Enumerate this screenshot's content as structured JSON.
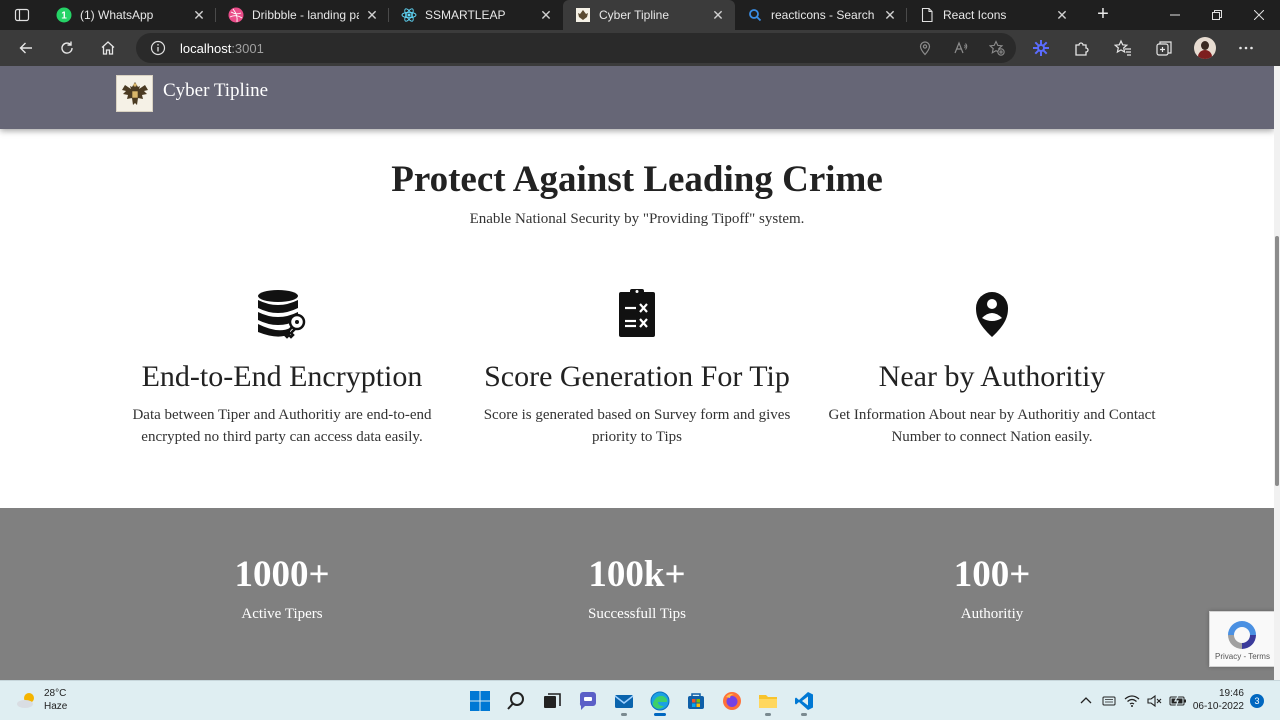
{
  "browser": {
    "tabs": [
      {
        "title": "(1) WhatsApp",
        "icon": "whatsapp-icon"
      },
      {
        "title": "Dribbble - landing pag",
        "icon": "dribbble-icon"
      },
      {
        "title": "SSMARTLEAP",
        "icon": "react-icon"
      },
      {
        "title": "Cyber Tipline",
        "icon": "site-logo-icon",
        "active": true
      },
      {
        "title": "reacticons - Search",
        "icon": "search-icon"
      },
      {
        "title": "React Icons",
        "icon": "document-icon"
      }
    ],
    "address": {
      "host": "localhost",
      "port": ":3001"
    }
  },
  "site": {
    "brand": "Cyber Tipline",
    "hero_title": "Protect Against Leading Crime",
    "hero_subtitle": "Enable National Security by \"Providing Tipoff\" system.",
    "features": [
      {
        "icon": "database-key-icon",
        "title": "End-to-End Encryption",
        "text": "Data between Tiper and Authoritiy are end-to-end encrypted no third party can access data easily."
      },
      {
        "icon": "clipboard-score-icon",
        "title": "Score Generation For Tip",
        "text": "Score is generated based on Survey form and gives priority to Tips"
      },
      {
        "icon": "location-person-icon",
        "title": "Near by Authoritiy",
        "text": "Get Information About near by Authoritiy and Contact Number to connect Nation easily."
      }
    ],
    "stats": [
      {
        "value": "1000+",
        "label": "Active Tipers"
      },
      {
        "value": "100k+",
        "label": "Successfull Tips"
      },
      {
        "value": "100+",
        "label": "Authoritiy"
      }
    ],
    "recaptcha": "Privacy - Terms",
    "colors": {
      "header_bg": "#666676",
      "stats_bg": "#808080"
    }
  },
  "taskbar": {
    "weather_temp": "28°C",
    "weather_desc": "Haze",
    "time": "19:46",
    "date": "06-10-2022",
    "notifications": "3"
  }
}
